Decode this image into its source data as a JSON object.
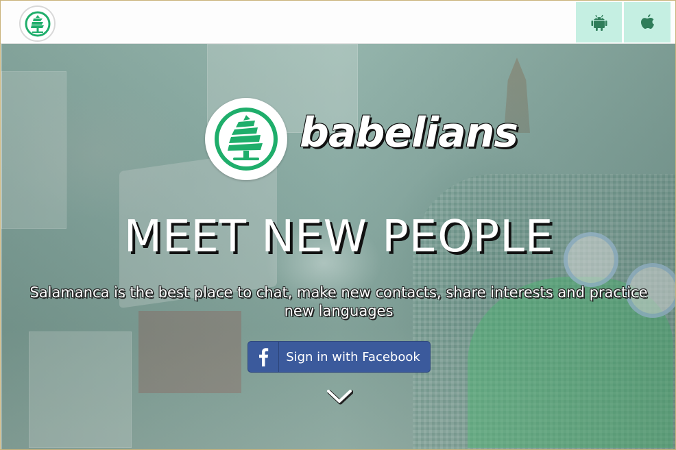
{
  "header": {
    "logo_icon": "tree-logo-icon",
    "store_links": [
      {
        "name": "android-store",
        "icon": "android-icon"
      },
      {
        "name": "apple-store",
        "icon": "apple-icon"
      }
    ],
    "store_bg_color": "#c5efe2",
    "icon_color": "#2f7d5a"
  },
  "hero": {
    "brand_name": "babelians",
    "brand_icon": "tree-logo-icon",
    "brand_color": "#1fae6b",
    "headline": "MEET NEW PEOPLE",
    "subtitle": "Salamanca is the best place to chat, make new contacts, share interests and practice new languages",
    "facebook_button": {
      "label": "Sign in with Facebook",
      "icon": "facebook-icon",
      "color": "#3b5a9c"
    },
    "scroll_icon": "chevron-down-icon"
  }
}
